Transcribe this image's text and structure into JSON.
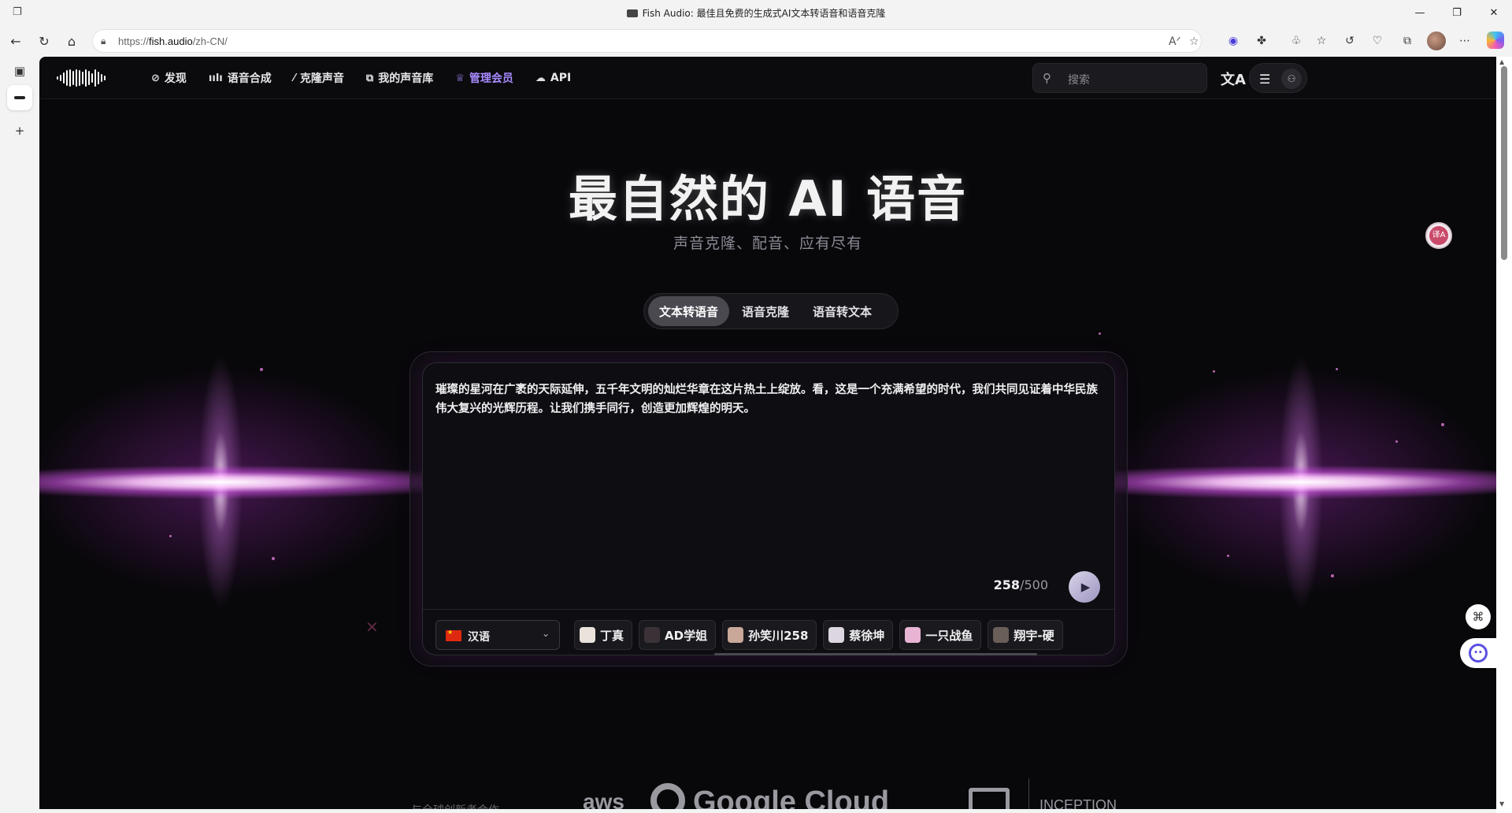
{
  "browser": {
    "tab_title": "Fish Audio: 最佳且免费的生成式AI文本转语音和语音克隆",
    "url_prefix": "https://",
    "url_host": "fish.audio",
    "url_path": "/zh-CN/"
  },
  "header": {
    "nav": [
      {
        "icon": "compass-icon",
        "label": "发现"
      },
      {
        "icon": "waveform-icon",
        "label": "语音合成"
      },
      {
        "icon": "magic-wand-icon",
        "label": "克隆声音"
      },
      {
        "icon": "library-icon",
        "label": "我的声音库"
      },
      {
        "icon": "crown-icon",
        "label": "管理会员"
      },
      {
        "icon": "cloud-icon",
        "label": "API"
      }
    ],
    "search_placeholder": "搜索",
    "accent_color": "#a88bff"
  },
  "hero": {
    "title": "最自然的 AI 语音",
    "subtitle": "声音克隆、配音、应有尽有"
  },
  "tabs": [
    {
      "label": "文本转语音",
      "active": true
    },
    {
      "label": "语音克隆",
      "active": false
    },
    {
      "label": "语音转文本",
      "active": false
    }
  ],
  "editor": {
    "text": "璀璨的星河在广袤的天际延伸，五千年文明的灿烂华章在这片热土上绽放。看，这是一个充满希望的时代，我们共同见证着中华民族伟大复兴的光辉历程。让我们携手同行，创造更加辉煌的明天。",
    "count": "258",
    "max": "/500",
    "language": "汉语",
    "voices": [
      "丁真",
      "AD学姐",
      "孙笑川258",
      "蔡徐坤",
      "一只战鱼",
      "翔宇-硬"
    ]
  },
  "partners": {
    "label": "与全球创新者合作",
    "names": [
      "aws",
      "Google Cloud",
      "INCEPTION"
    ]
  },
  "floating": {
    "translate_badge": "译A"
  }
}
